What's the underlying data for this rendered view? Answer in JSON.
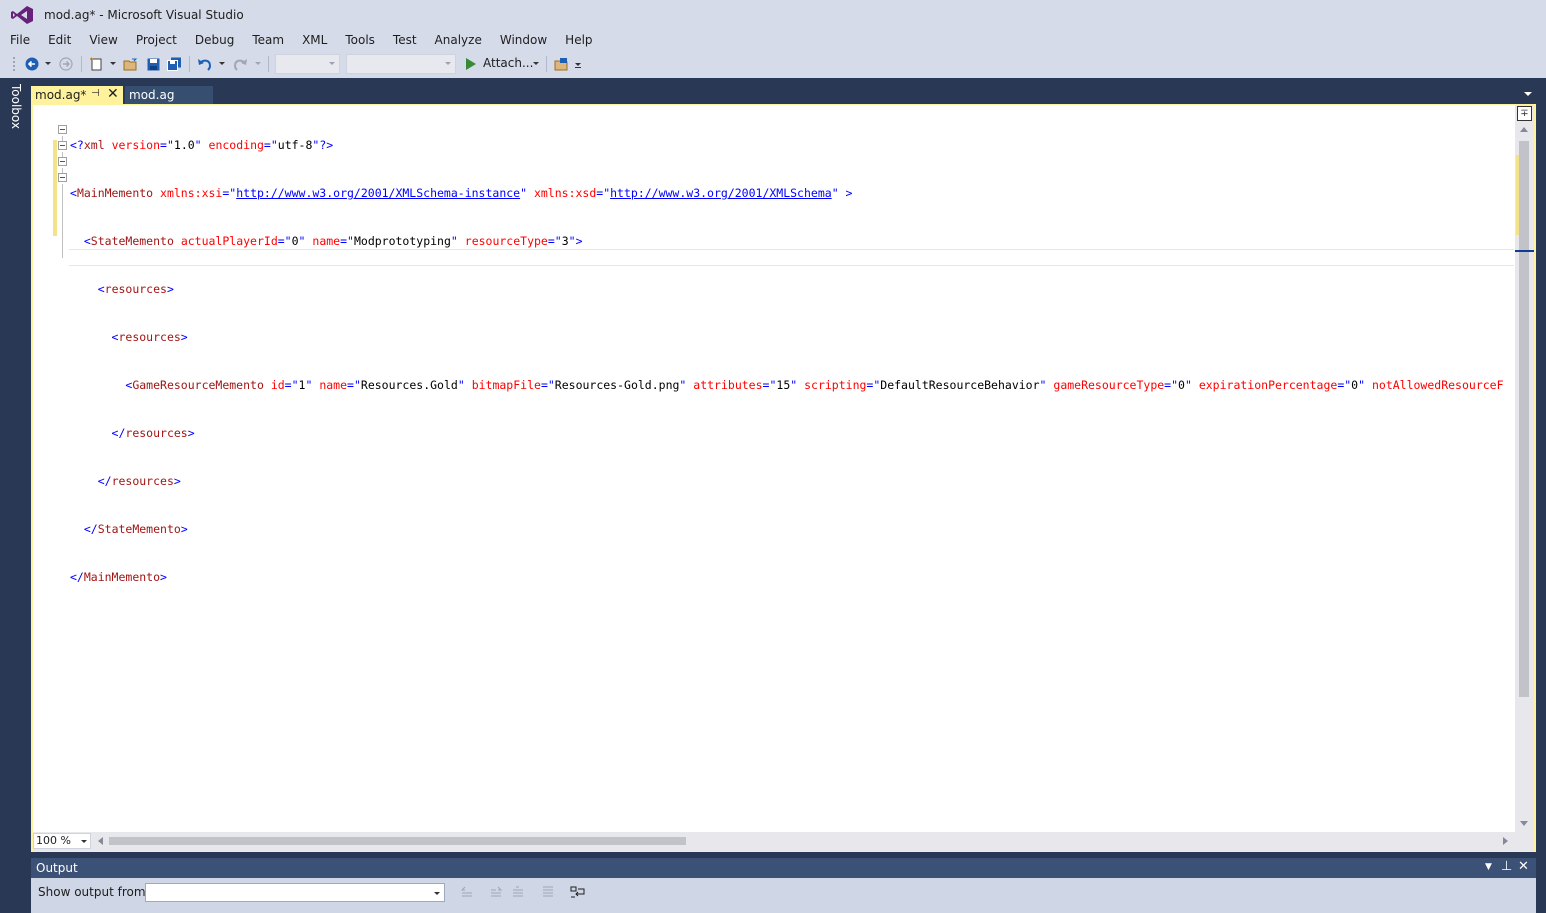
{
  "window": {
    "title": "mod.ag* - Microsoft Visual Studio"
  },
  "menu": [
    "File",
    "Edit",
    "View",
    "Project",
    "Debug",
    "Team",
    "XML",
    "Tools",
    "Test",
    "Analyze",
    "Window",
    "Help"
  ],
  "toolbar": {
    "attach_label": "Attach..."
  },
  "toolbox": {
    "label": "Toolbox"
  },
  "tabs": [
    {
      "label": "mod.ag*",
      "active": true
    },
    {
      "label": "mod.ag",
      "active": false
    }
  ],
  "code": {
    "line1": {
      "a": "<?",
      "b": "xml",
      "c": " version",
      "d": "=\"",
      "e": "1.0",
      "f": "\" ",
      "g": "encoding",
      "h": "=\"",
      "i": "utf-8",
      "j": "\"?>"
    },
    "line2": {
      "a": "<",
      "b": "MainMemento",
      "c": " xmlns:xsi",
      "d": "=\"",
      "e": "http://www.w3.org/2001/XMLSchema-instance",
      "f": "\" ",
      "g": "xmlns:xsd",
      "h": "=\"",
      "i": "http://www.w3.org/2001/XMLSchema",
      "j": "\" >"
    },
    "line3": {
      "a": "<",
      "b": "StateMemento",
      "c": " actualPlayerId",
      "d": "=\"",
      "e": "0",
      "f": "\" ",
      "g": "name",
      "h": "=\"",
      "i": "Modprototyping",
      "j": "\" ",
      "k": "resourceType",
      "l": "=\"",
      "m": "3",
      "n": "\">"
    },
    "line4": {
      "a": "<",
      "b": "resources",
      "c": ">"
    },
    "line5": {
      "a": "<",
      "b": "resources",
      "c": ">"
    },
    "line6": {
      "a": "<",
      "b": "GameResourceMemento",
      "a1": " id",
      "v1": "1",
      "a2": "name",
      "v2": "Resources.Gold",
      "a3": "bitmapFile",
      "v3": "Resources-Gold.png",
      "a4": "attributes",
      "v4": "15",
      "a5": "scripting",
      "v5": "DefaultResourceBehavior",
      "a6": "gameResourceType",
      "v6": "0",
      "a7": "expirationPercentage",
      "v7": "0",
      "a8": "notAllowedResourceF"
    },
    "line7": {
      "a": "</",
      "b": "resources",
      "c": ">"
    },
    "line8": {
      "a": "</",
      "b": "resources",
      "c": ">"
    },
    "line9": {
      "a": "</",
      "b": "StateMemento",
      "c": ">"
    },
    "line10": {
      "a": "</",
      "b": "MainMemento",
      "c": ">"
    }
  },
  "editor": {
    "zoom": "100 %"
  },
  "output": {
    "title": "Output",
    "show_from_label": "Show output from:",
    "show_from_value": ""
  },
  "colors": {
    "accent_tab": "#fff29d",
    "frame": "#293955",
    "chrome": "#d6dbe9"
  }
}
